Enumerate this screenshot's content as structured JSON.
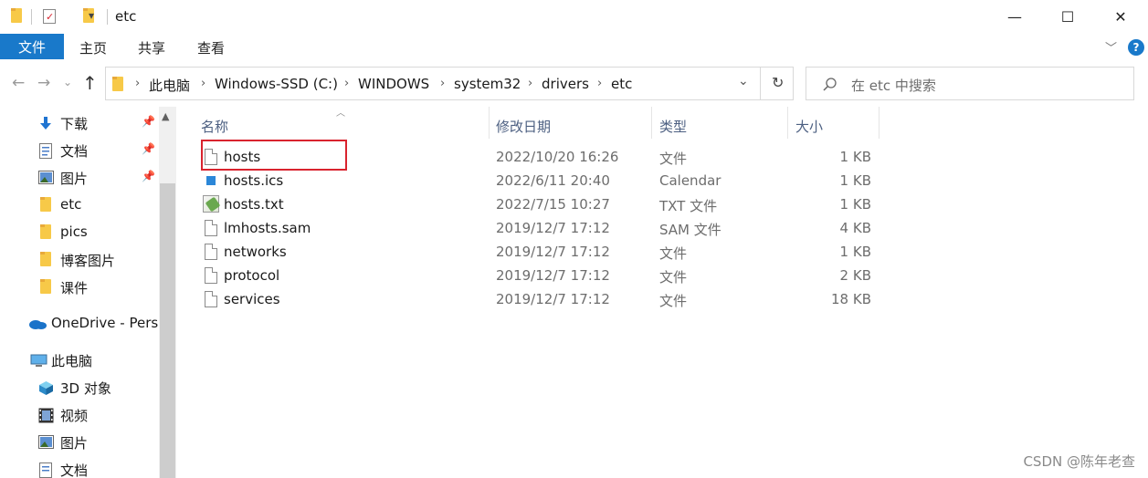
{
  "titlebar": {
    "title": "etc",
    "minimize": "—",
    "maximize": "☐",
    "close": "✕",
    "dropdown": "▾"
  },
  "ribbon": {
    "tabs": [
      "文件",
      "主页",
      "共享",
      "查看"
    ],
    "collapse": "﹀",
    "help": "?"
  },
  "address": {
    "breadcrumbs": [
      "此电脑",
      "Windows-SSD (C:)",
      "WINDOWS",
      "system32",
      "drivers",
      "etc"
    ],
    "back": "←",
    "forward": "→",
    "recent": "⌄",
    "up": "↑",
    "history_dropdown": "⌄",
    "refresh": "↻",
    "search_placeholder": "在 etc 中搜索"
  },
  "nav": {
    "items": [
      {
        "label": "下载",
        "icon": "download-icon",
        "pinned": true
      },
      {
        "label": "文档",
        "icon": "document-icon",
        "pinned": true
      },
      {
        "label": "图片",
        "icon": "pictures-icon",
        "pinned": true
      },
      {
        "label": "etc",
        "icon": "folder-icon",
        "pinned": false
      },
      {
        "label": "pics",
        "icon": "folder-icon",
        "pinned": false
      },
      {
        "label": "博客图片",
        "icon": "folder-icon",
        "pinned": false
      },
      {
        "label": "课件",
        "icon": "folder-icon",
        "pinned": false
      },
      {
        "label": "OneDrive - Personal",
        "icon": "onedrive-icon",
        "pinned": false
      },
      {
        "label": "此电脑",
        "icon": "this-pc-icon",
        "pinned": false
      },
      {
        "label": "3D 对象",
        "icon": "3d-objects-icon",
        "pinned": false
      },
      {
        "label": "视频",
        "icon": "video-icon",
        "pinned": false
      },
      {
        "label": "图片",
        "icon": "pictures-icon",
        "pinned": false
      },
      {
        "label": "文档",
        "icon": "document-icon",
        "pinned": false
      }
    ]
  },
  "filelist": {
    "columns": [
      "名称",
      "修改日期",
      "类型",
      "大小"
    ],
    "rows": [
      {
        "name": "hosts",
        "date": "2022/10/20 16:26",
        "type": "文件",
        "size": "1 KB",
        "icon": "file-icon"
      },
      {
        "name": "hosts.ics",
        "date": "2022/6/11 20:40",
        "type": "Calendar",
        "size": "1 KB",
        "icon": "calendar-file-icon"
      },
      {
        "name": "hosts.txt",
        "date": "2022/7/15 10:27",
        "type": "TXT 文件",
        "size": "1 KB",
        "icon": "text-file-icon"
      },
      {
        "name": "lmhosts.sam",
        "date": "2019/12/7 17:12",
        "type": "SAM 文件",
        "size": "4 KB",
        "icon": "file-icon"
      },
      {
        "name": "networks",
        "date": "2019/12/7 17:12",
        "type": "文件",
        "size": "1 KB",
        "icon": "file-icon"
      },
      {
        "name": "protocol",
        "date": "2019/12/7 17:12",
        "type": "文件",
        "size": "2 KB",
        "icon": "file-icon"
      },
      {
        "name": "services",
        "date": "2019/12/7 17:12",
        "type": "文件",
        "size": "18 KB",
        "icon": "file-icon"
      }
    ]
  },
  "watermark": "CSDN @陈年老查",
  "colors": {
    "accent": "#1979ca",
    "highlight": "#d9232e",
    "folder": "#f7c948"
  }
}
